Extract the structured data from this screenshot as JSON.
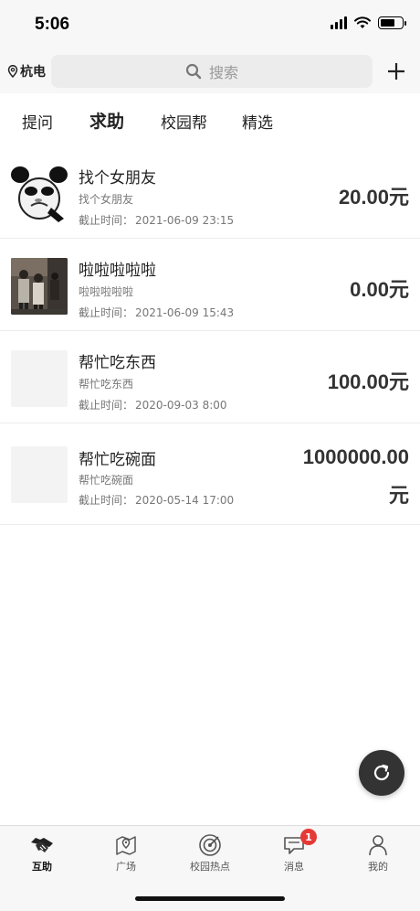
{
  "status_bar": {
    "time": "5:06"
  },
  "header": {
    "location": "杭电",
    "search_placeholder": "搜索"
  },
  "tabs": [
    {
      "label": "提问",
      "active": false
    },
    {
      "label": "求助",
      "active": true
    },
    {
      "label": "校园帮",
      "active": false
    },
    {
      "label": "精选",
      "active": false
    }
  ],
  "list": [
    {
      "title": "找个女朋友",
      "desc": "找个女朋友",
      "deadline_label": "截止时间：",
      "deadline": "2021-06-09 23:15",
      "price": "20.00元",
      "thumb": "panda-meme-image"
    },
    {
      "title": "啦啦啦啦啦",
      "desc": "啦啦啦啦啦",
      "deadline_label": "截止时间：",
      "deadline": "2021-06-09 15:43",
      "price": "0.00元",
      "thumb": "people-photo"
    },
    {
      "title": "帮忙吃东西",
      "desc": "帮忙吃东西",
      "deadline_label": "截止时间：",
      "deadline": "2020-09-03 8:00",
      "price": "100.00元",
      "thumb": "blank-thumbnail"
    },
    {
      "title": "帮忙吃碗面",
      "desc": "帮忙吃碗面",
      "deadline_label": "截止时间：",
      "deadline": "2020-05-14 17:00",
      "price_line1": "1000000.00",
      "price_line2": "元",
      "thumb": "blank-thumbnail"
    }
  ],
  "bottom_nav": [
    {
      "label": "互助",
      "icon": "handshake-icon",
      "active": true
    },
    {
      "label": "广场",
      "icon": "map-pin-icon",
      "active": false
    },
    {
      "label": "校园热点",
      "icon": "target-icon",
      "active": false
    },
    {
      "label": "消息",
      "icon": "message-icon",
      "active": false,
      "badge": "1"
    },
    {
      "label": "我的",
      "icon": "user-icon",
      "active": false
    }
  ],
  "colors": {
    "badge": "#e53935",
    "fab": "#333333"
  }
}
